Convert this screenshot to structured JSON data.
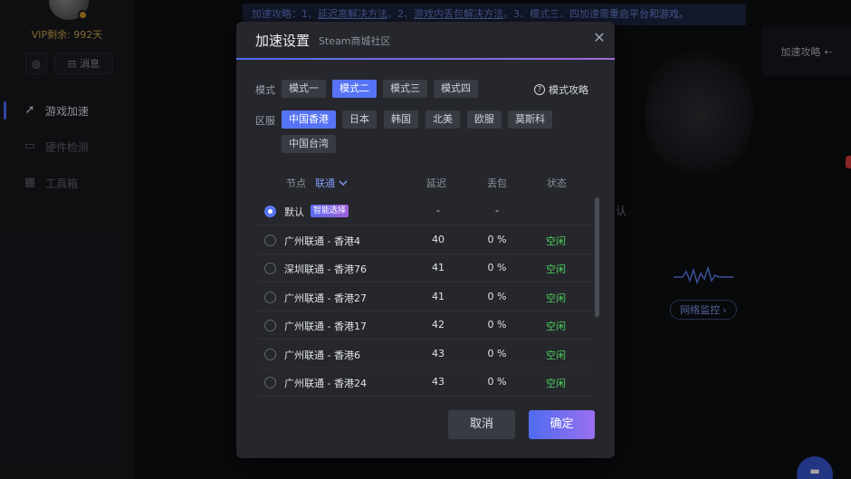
{
  "sidebar": {
    "vip_text": "VIP剩余: 992天",
    "message_label": "消息",
    "items": [
      {
        "label": "游戏加速",
        "icon": "rocket-icon"
      },
      {
        "label": "硬件检测",
        "icon": "monitor-icon"
      },
      {
        "label": "工具箱",
        "icon": "toolbox-icon"
      }
    ]
  },
  "background": {
    "tip_prefix": "加速攻略：1、",
    "tip_link1": "延迟高解决方法",
    "tip_mid1": "。2、",
    "tip_link2": "游戏内丢包解决方法",
    "tip_suffix": "。3、模式三、四加速需重启平台和游戏。",
    "right_panel_label": "加速攻略",
    "bg_text": "认",
    "net_monitor_label": "网络监控"
  },
  "dialog": {
    "title": "加速设置",
    "subtitle": "Steam商城社区",
    "mode_label": "模式",
    "modes": [
      "模式一",
      "模式二",
      "模式三",
      "模式四"
    ],
    "selected_mode": "模式二",
    "guide_label": "模式攻略",
    "region_label": "区服",
    "regions": [
      "中国香港",
      "日本",
      "韩国",
      "北美",
      "欧服",
      "莫斯科",
      "中国台湾"
    ],
    "selected_region": "中国香港",
    "columns": {
      "node": "节点",
      "isp": "联通",
      "latency": "延迟",
      "loss": "丢包",
      "status": "状态"
    },
    "rows": [
      {
        "name": "默认",
        "tag": "智能选择",
        "latency": "-",
        "loss": "-",
        "status": "",
        "selected": true
      },
      {
        "name": "广州联通 - 香港4",
        "tag": "",
        "latency": "40",
        "loss": "0 %",
        "status": "空闲",
        "selected": false
      },
      {
        "name": "深圳联通 - 香港76",
        "tag": "",
        "latency": "41",
        "loss": "0 %",
        "status": "空闲",
        "selected": false
      },
      {
        "name": "广州联通 - 香港27",
        "tag": "",
        "latency": "41",
        "loss": "0 %",
        "status": "空闲",
        "selected": false
      },
      {
        "name": "广州联通 - 香港17",
        "tag": "",
        "latency": "42",
        "loss": "0 %",
        "status": "空闲",
        "selected": false
      },
      {
        "name": "广州联通 - 香港6",
        "tag": "",
        "latency": "43",
        "loss": "0 %",
        "status": "空闲",
        "selected": false
      },
      {
        "name": "广州联通 - 香港24",
        "tag": "",
        "latency": "43",
        "loss": "0 %",
        "status": "空闲",
        "selected": false
      }
    ],
    "cancel_label": "取消",
    "confirm_label": "确定"
  },
  "colors": {
    "accent": "#5673f5",
    "status_idle": "#4ccf5a",
    "vip": "#c9a24a"
  }
}
